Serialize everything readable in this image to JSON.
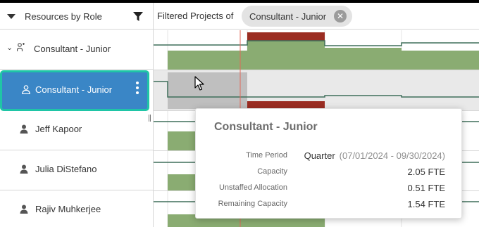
{
  "sidebar": {
    "header_title": "Resources by Role",
    "group": {
      "label": "Consultant - Junior"
    },
    "selected": {
      "label": "Consultant - Junior"
    },
    "resources": [
      {
        "label": "Jeff Kapoor"
      },
      {
        "label": "Julia DiStefano"
      },
      {
        "label": "Rajiv Muhkerjee"
      }
    ]
  },
  "header": {
    "filter_title": "Filtered Projects of",
    "chip_label": "Consultant - Junior"
  },
  "tooltip": {
    "title": "Consultant - Junior",
    "rows": [
      {
        "key": "Time Period",
        "value_quarter": "Quarter",
        "value_range": "(07/01/2024 - 09/30/2024)"
      },
      {
        "key": "Capacity",
        "value": "2.05 FTE"
      },
      {
        "key": "Unstaffed Allocation",
        "value": "0.51 FTE"
      },
      {
        "key": "Remaining Capacity",
        "value": "1.54 FTE"
      }
    ]
  },
  "colors": {
    "allocation_green": "#8aac72",
    "overallocation_red": "#9b2d22",
    "selected_blue": "#3a86c6",
    "selection_teal": "#1fc5a6",
    "today_line": "#e06a5b",
    "capacity_line": "#3f6f5a"
  },
  "icons": [
    "funnel-icon",
    "caret-down-icon",
    "chevron-down-icon",
    "role-group-icon",
    "person-icon",
    "kebab-icon",
    "close-icon",
    "pointer-cursor-icon"
  ]
}
